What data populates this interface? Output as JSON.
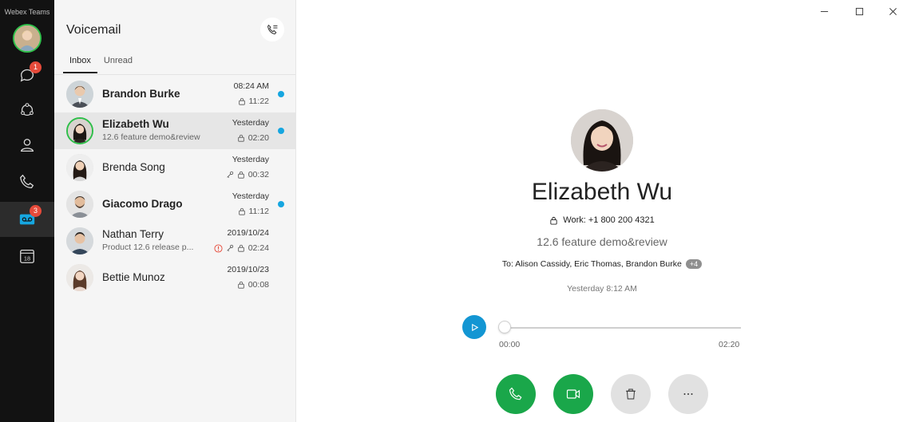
{
  "app": {
    "title": "Webex Teams"
  },
  "rail": {
    "messages_badge": "1",
    "voicemail_badge": "3",
    "calendar_day": "18"
  },
  "list": {
    "title": "Voicemail",
    "tabs": [
      {
        "label": "Inbox",
        "active": true
      },
      {
        "label": "Unread",
        "active": false
      }
    ],
    "items": [
      {
        "name": "Brandon Burke",
        "subtitle": "",
        "date": "08:24 AM",
        "duration": "11:22",
        "unread": true,
        "bold": true
      },
      {
        "name": "Elizabeth Wu",
        "subtitle": "12.6 feature demo&review",
        "date": "Yesterday",
        "duration": "02:20",
        "unread": true,
        "bold": true
      },
      {
        "name": "Brenda Song",
        "subtitle": "",
        "date": "Yesterday",
        "duration": "00:32",
        "unread": false,
        "bold": false
      },
      {
        "name": "Giacomo Drago",
        "subtitle": "",
        "date": "Yesterday",
        "duration": "11:12",
        "unread": true,
        "bold": true
      },
      {
        "name": "Nathan Terry",
        "subtitle": "Product 12.6 release p...",
        "date": "2019/10/24",
        "duration": "02:24",
        "unread": false,
        "bold": false
      },
      {
        "name": "Bettie Munoz",
        "subtitle": "",
        "date": "2019/10/23",
        "duration": "00:08",
        "unread": false,
        "bold": false
      }
    ]
  },
  "detail": {
    "name": "Elizabeth Wu",
    "work": "Work: +1 800 200 4321",
    "subject": "12.6 feature demo&review",
    "to": "To: Alison Cassidy, Eric Thomas, Brandon Burke",
    "to_more": "+4",
    "time": "Yesterday 8:12 AM",
    "player": {
      "current": "00:00",
      "total": "02:20",
      "progress": 0
    }
  },
  "colors": {
    "rail_bg": "#121212",
    "accent_blue": "#1396d3",
    "unread_dot": "#16a6e0",
    "call_green": "#1aa74a",
    "badge_red": "#e64a3a"
  }
}
